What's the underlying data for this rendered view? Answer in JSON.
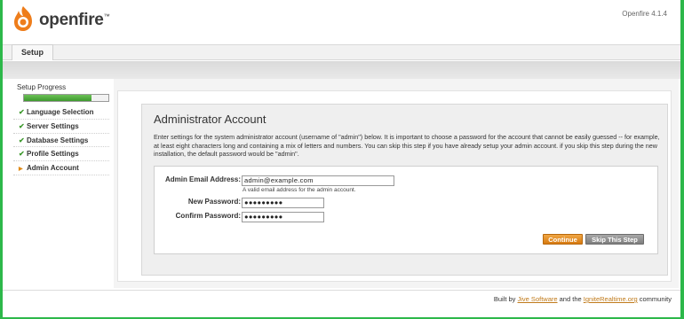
{
  "header": {
    "logo_text": "openfire",
    "logo_tm": "™",
    "version": "Openfire 4.1.4"
  },
  "tabs": [
    {
      "label": "Setup"
    }
  ],
  "sidebar": {
    "title": "Setup Progress",
    "progress": 0.8,
    "items": [
      {
        "label": "Language Selection",
        "state": "done"
      },
      {
        "label": "Server Settings",
        "state": "done"
      },
      {
        "label": "Database Settings",
        "state": "done"
      },
      {
        "label": "Profile Settings",
        "state": "done"
      },
      {
        "label": "Admin Account",
        "state": "current"
      }
    ]
  },
  "main": {
    "title": "Administrator Account",
    "description": "Enter settings for the system administrator account (username of \"admin\") below. It is important to choose a password for the account that cannot be easily guessed -- for example, at least eight characters long and containing a mix of letters and numbers. You can skip this step if you have already setup your admin account. if you skip this step during the new installation, the default password would be \"admin\".",
    "form": {
      "email_label": "Admin Email Address:",
      "email_value": "admin@example.com",
      "email_hint": "A valid email address for the admin account.",
      "new_password_label": "New Password:",
      "new_password_value": "●●●●●●●●●",
      "confirm_password_label": "Confirm Password:",
      "confirm_password_value": "●●●●●●●●●"
    },
    "buttons": {
      "continue": "Continue",
      "skip": "Skip This Step"
    }
  },
  "footer": {
    "prefix": "Built by",
    "link1": "Jive Software",
    "middle": "and the",
    "link2": "IgniteRealtime.org",
    "suffix": "community"
  },
  "colors": {
    "accent_orange": "#e8821a",
    "frame_green": "#2db84a",
    "progress_green": "#4caf3a"
  }
}
